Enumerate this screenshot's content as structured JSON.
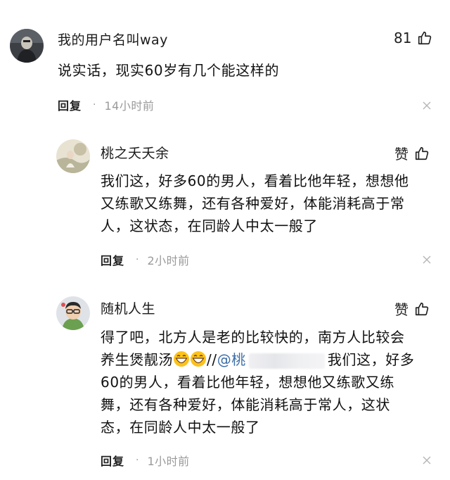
{
  "comments": [
    {
      "username": "我的用户名叫way",
      "text": "说实话，现实60岁有几个能这样的",
      "likes": "81",
      "reply_label": "回复",
      "separator": "·",
      "time": "14小时前"
    }
  ],
  "replies": [
    {
      "username": "桃之夭夭余",
      "like_label": "赞",
      "lines": [
        "我们这，好多60的男人，看着比他年轻，想想他",
        "又练歌又练舞，还有各种爱好，体能消耗高于常",
        "人，这状态，在同龄人中太一般了"
      ],
      "reply_label": "回复",
      "separator": "·",
      "time": "2小时前"
    },
    {
      "username": "随机人生",
      "like_label": "赞",
      "line1": "得了吧，北方人是老的比较快的，南方人比较会",
      "line2_start": "养生煲靓汤",
      "line2_sep": "//",
      "mention": "@桃",
      "line2_end": "我们这，好多",
      "lines_rest": [
        "60的男人，看着比他年轻，想想他又练歌又练",
        "舞，还有各种爱好，体能消耗高于常人，这状",
        "态，在同龄人中太一般了"
      ],
      "reply_label": "回复",
      "separator": "·",
      "time": "1小时前"
    }
  ],
  "icons": {
    "like": "thumbs-up-icon",
    "close": "close-icon",
    "emoji": "grinning-emoji-icon"
  },
  "colors": {
    "mention": "#3b6ea8",
    "meta_gray": "#9a9a9a"
  }
}
